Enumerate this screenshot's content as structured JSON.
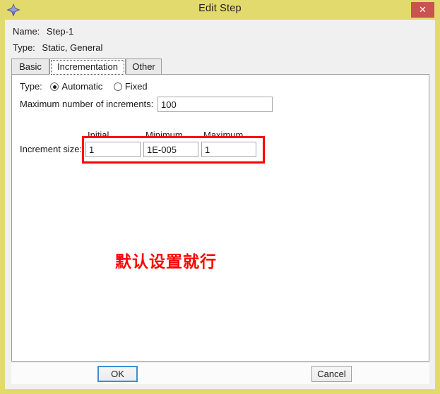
{
  "window": {
    "title": "Edit Step",
    "icon": "abaqus-diamond-icon",
    "close_label": "✕",
    "titlebar_color": "#e3da6e",
    "close_button_color": "#c9534f"
  },
  "header": {
    "name_label": "Name:",
    "name_value": "Step-1",
    "type_label": "Type:",
    "type_value": "Static, General"
  },
  "tabs": [
    {
      "label": "Basic",
      "active": false
    },
    {
      "label": "Incrementation",
      "active": true
    },
    {
      "label": "Other",
      "active": false
    }
  ],
  "panel": {
    "type_label": "Type:",
    "radios": [
      {
        "label": "Automatic",
        "checked": true
      },
      {
        "label": "Fixed",
        "checked": false
      }
    ],
    "max_increments_label": "Maximum number of increments:",
    "max_increments_value": "100",
    "increment_size_label": "Increment size:",
    "columns": [
      "Initial",
      "Minimum",
      "Maximum"
    ],
    "increment_values": {
      "initial": "1",
      "minimum": "1E-005",
      "maximum": "1"
    }
  },
  "annotations": {
    "box_color": "#fe0000",
    "note_text": "默认设置就行",
    "note_color": "#fe0000"
  },
  "buttons": {
    "ok": "OK",
    "cancel": "Cancel"
  }
}
